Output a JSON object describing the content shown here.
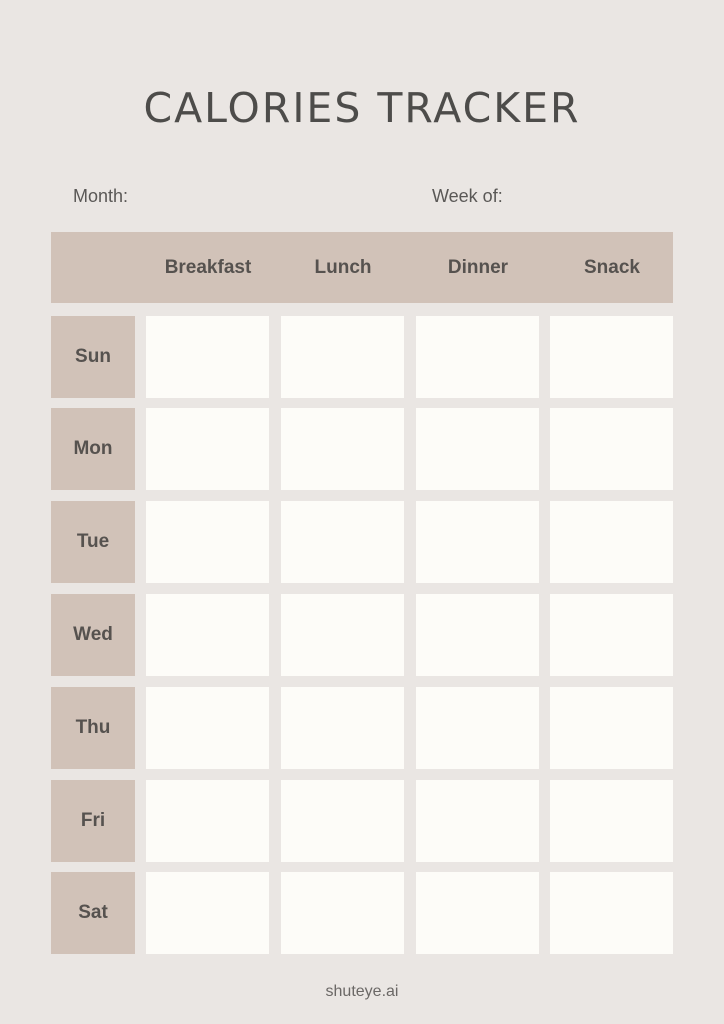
{
  "title": "CALORIES TRACKER",
  "fields": {
    "month_label": "Month:",
    "month_value": "",
    "week_label": "Week of:",
    "week_value": ""
  },
  "table": {
    "columns": [
      "Breakfast",
      "Lunch",
      "Dinner",
      "Snack"
    ],
    "rows": [
      {
        "day": "Sun",
        "cells": [
          "",
          "",
          "",
          ""
        ]
      },
      {
        "day": "Mon",
        "cells": [
          "",
          "",
          "",
          ""
        ]
      },
      {
        "day": "Tue",
        "cells": [
          "",
          "",
          "",
          ""
        ]
      },
      {
        "day": "Wed",
        "cells": [
          "",
          "",
          "",
          ""
        ]
      },
      {
        "day": "Thu",
        "cells": [
          "",
          "",
          "",
          ""
        ]
      },
      {
        "day": "Fri",
        "cells": [
          "",
          "",
          "",
          ""
        ]
      },
      {
        "day": "Sat",
        "cells": [
          "",
          "",
          "",
          ""
        ]
      }
    ]
  },
  "footer": "shuteye.ai",
  "colors": {
    "background": "#eae6e3",
    "header_band": "#d1c2b8",
    "cell": "#fdfcf8",
    "text": "#4f4d4b"
  }
}
